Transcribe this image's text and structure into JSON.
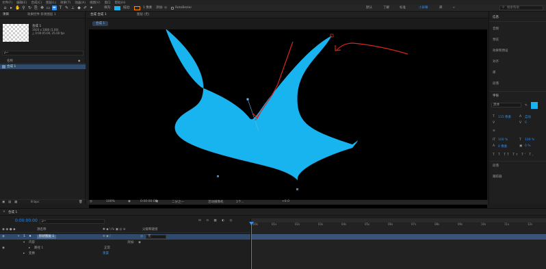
{
  "menubar": {
    "items": [
      "文件(F)",
      "编辑(E)",
      "合成(C)",
      "图层(L)",
      "效果(T)",
      "动画(A)",
      "视图(V)",
      "窗口",
      "帮助(H)"
    ]
  },
  "toolbar": {
    "workspaces": [
      "默认",
      "了解",
      "标准",
      "小屏幕",
      "库"
    ],
    "active_workspace": "默认",
    "search_placeholder": "搜索帮助",
    "snap_label": "对齐",
    "extend_label": "Extend"
  },
  "project": {
    "tab": "项目",
    "tab2": "效果控件 形状图层 1",
    "comp_name": "合成 1",
    "comp_info1": "1920 x 1080 (1.00)",
    "comp_info2": "△ 0:00:05:00, 25.00 fps",
    "search_placeholder": "ρ~",
    "col_name": "名称",
    "item_name": "合成 1",
    "bpc": "8 bpc"
  },
  "comp": {
    "tab_label": "合成 合成 1",
    "tab2": "图层 (无)",
    "breadcrumb": "合成 1",
    "zoom": "100%",
    "time": "0:00:00:00",
    "resolution": "二分之一",
    "camera": "活动摄像机",
    "views": "1个...",
    "offset": "+0.0"
  },
  "right": {
    "tab": "信息",
    "items": [
      "音频",
      "预览",
      "效果和预设",
      "对齐",
      "库",
      "段落",
      "字符"
    ],
    "char_font": "黑体",
    "char_size": "115 像素",
    "char_lead": "自动",
    "char_tracking": "0",
    "char_scale_v": "100 %",
    "char_scale_h": "100 %",
    "char_baseline": "0 像素",
    "char_tsume": "0 %",
    "bottom_items": [
      "段落",
      "跟踪器"
    ]
  },
  "timeline": {
    "tab": "合成 1",
    "timecode": "0:00:00:00",
    "search_placeholder": "ρ~",
    "col_source": "源名称",
    "col_mode": "父级和链接",
    "layer_num": "1",
    "layer_name": "形状图层 1",
    "parent": "无",
    "sub1": "内容",
    "sub1_add": "添加:",
    "sub2": "路径 1",
    "sub2_mode": "正常",
    "sub3": "变换",
    "sub3_val": "重置",
    "ticks": [
      "0:00s",
      "01s",
      "02s",
      "03s",
      "04s",
      "05s",
      "06s",
      "07s",
      "08s",
      "09s",
      "10s",
      "11s",
      "12s"
    ]
  },
  "shape": {
    "fill": "#18b4f0"
  },
  "annotation": {
    "arrow_color": "#d8261f"
  }
}
